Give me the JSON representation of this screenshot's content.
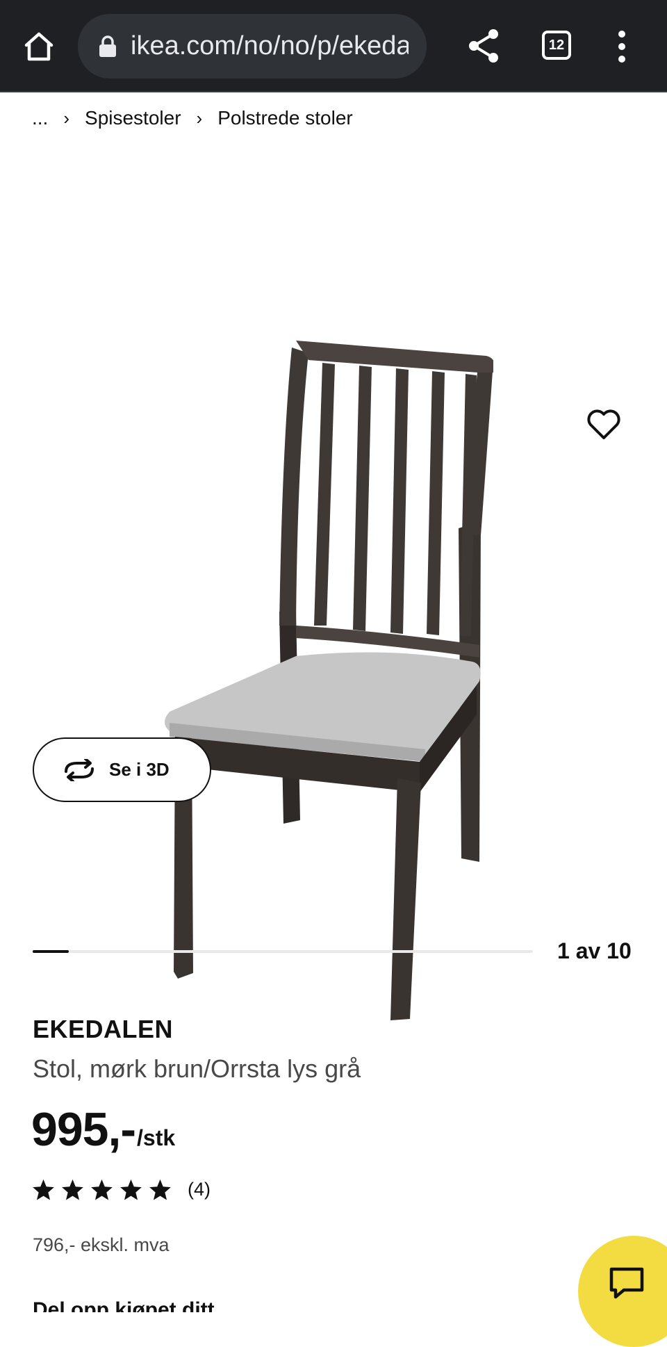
{
  "browser": {
    "url": "ikea.com/no/no/p/ekedalen",
    "tab_count": "12",
    "icons": [
      "home-icon",
      "lock-icon",
      "share-icon",
      "tabs-icon",
      "more-vert-icon"
    ]
  },
  "breadcrumb": {
    "ellipsis": "...",
    "items": [
      "Spisestoler",
      "Polstrede stoler"
    ]
  },
  "gallery": {
    "see_3d_label": "Se i 3D",
    "counter": "1 av 10",
    "progress_fraction": 0.1
  },
  "product": {
    "name": "EKEDALEN",
    "description": "Stol, mørk brun/Orrsta lys grå",
    "price": "995,-",
    "price_unit": "/stk",
    "rating_stars": 5,
    "review_count": "(4)",
    "price_ex_vat": "796,- ekskl. mva",
    "next_section_partial": "Del opp kjøpet ditt"
  },
  "colors": {
    "chrome": "#1f2023",
    "urlbar": "#2f3338",
    "chair_wood": "#3f3936",
    "seat": "#c4c4c4",
    "chat_button": "#f2dc42"
  }
}
